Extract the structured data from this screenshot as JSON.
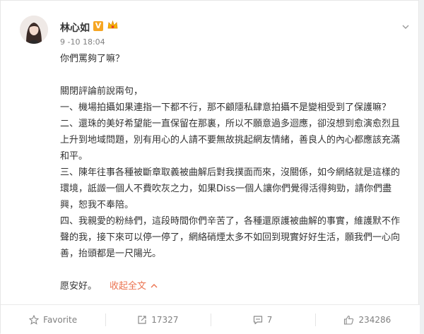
{
  "user": {
    "name": "林心如",
    "verified_badge": "V",
    "vip_badge_icon": "vip-crown-icon"
  },
  "post": {
    "timestamp": "9 -10 18:04",
    "paragraphs": [
      "你們罵夠了嘛？",
      "",
      "關閉評論前說兩句，",
      "一、機場拍攝如果連指一下都不行，那不顧隱私肆意拍攝不是變相受到了保護嘛？",
      "二、還珠的美好希望能一直保留在那裏，所以不願意過多迴應，卻沒想到愈演愈烈且上升到地域問題，別有用心的人請不要無故挑起網友情緒，善良人的內心都應該充滿和平。",
      "三、陳年往事各種被斷章取義被曲解后對我撲面而來，沒關係，如今網絡就是這樣的環境，詆譭一個人不費吹灰之力，如果Diss一個人讓你們覺得活得夠勁，請你們盡興，恕我不奉陪。",
      "四、我親愛的粉絲們，這段時間你們辛苦了，各種還原護被曲解的事實，維護默不作聲的我，接下來可以停一停了，網絡硝煙太多不如回到現實好好生活，願我們一心向善，抬頭都是一尺陽光。",
      "",
      "愿安好。"
    ],
    "collapse_label": "收起全文"
  },
  "actions": {
    "favorite_label": "Favorite",
    "repost_count": "17327",
    "comment_count": "7",
    "like_count": "234286"
  },
  "colors": {
    "accent_link": "#eb7350",
    "verified": "#f6a623"
  }
}
